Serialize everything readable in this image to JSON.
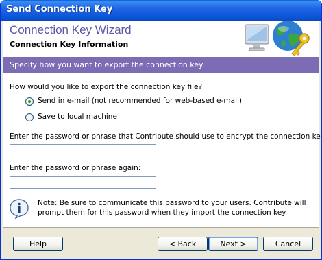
{
  "window": {
    "title": "Send Connection Key"
  },
  "banner": {
    "title": "Connection Key Wizard",
    "subtitle": "Connection Key Information"
  },
  "instruction": "Specify how you want to export the connection key.",
  "export": {
    "question": "How would you like to export the connection key file?",
    "options": [
      {
        "label": "Send in e-mail (not recommended for web-based e-mail)",
        "selected": true
      },
      {
        "label": "Save to local machine",
        "selected": false
      }
    ]
  },
  "password": {
    "label": "Enter the password or phrase that Contribute should use to encrypt the connection key:",
    "value": ""
  },
  "password_again": {
    "label": "Enter the password or phrase again:",
    "value": ""
  },
  "note": {
    "icon": "info-icon",
    "text": "Note: Be sure to communicate this password to your users. Contribute will prompt them for this password when they import the connection key."
  },
  "buttons": {
    "help": "Help",
    "back": "< Back",
    "next": "Next >",
    "cancel": "Cancel"
  },
  "colors": {
    "banner_title": "#5a5aa6",
    "instruction_bar": "#7b6cb4",
    "titlebar": "#0a55d6"
  }
}
